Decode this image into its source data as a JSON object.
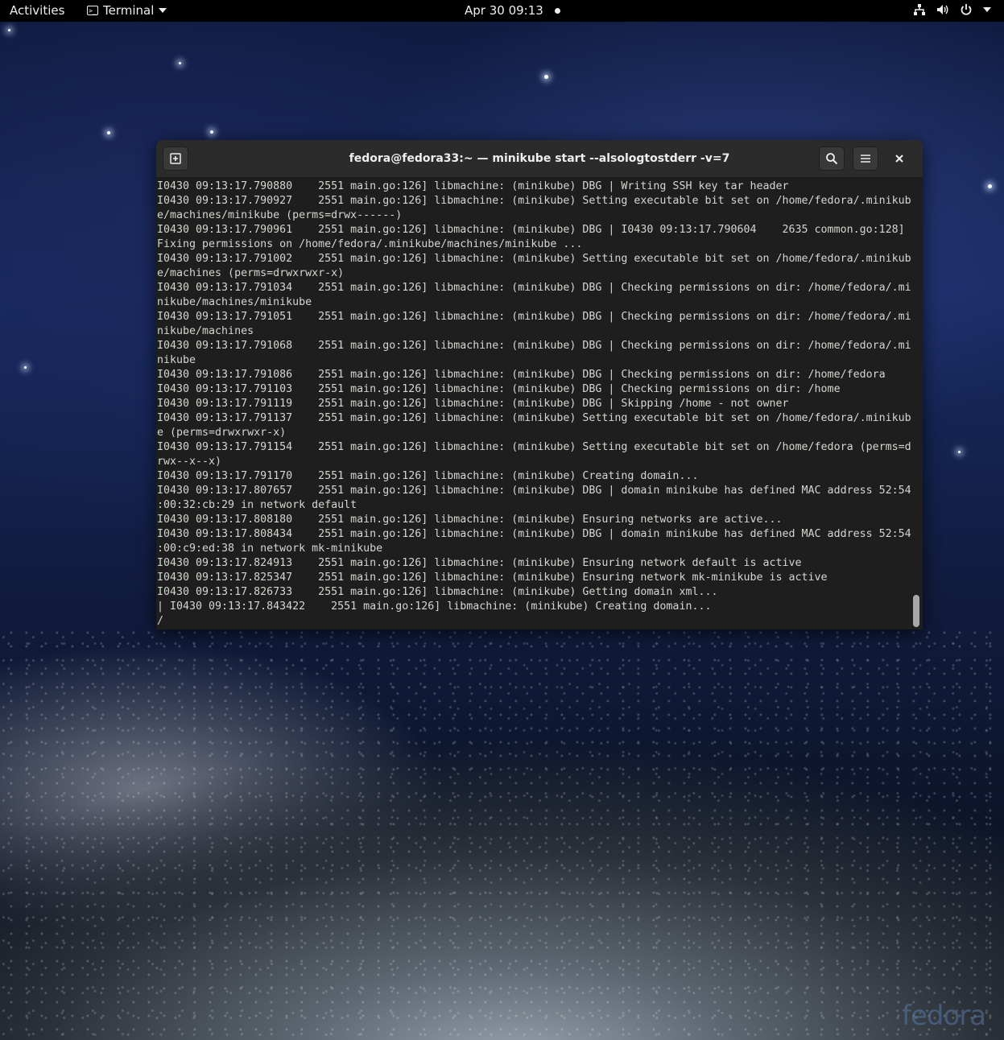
{
  "topbar": {
    "activities": "Activities",
    "app_name": "Terminal",
    "app_icon": "terminal-app-icon",
    "clock": "Apr 30  09:13",
    "status_icons": [
      "network-wired-icon",
      "volume-icon",
      "power-icon",
      "chevron-down-icon"
    ]
  },
  "window": {
    "title": "fedora@fedora33:~ — minikube start --alsologtostderr -v=7",
    "new_tab_icon": "new-tab-icon",
    "search_icon": "search-icon",
    "menu_icon": "hamburger-menu-icon",
    "close_icon": "close-icon"
  },
  "terminal": {
    "lines": [
      "I0430 09:13:17.790880    2551 main.go:126] libmachine: (minikube) DBG | Writing SSH key tar header",
      "I0430 09:13:17.790927    2551 main.go:126] libmachine: (minikube) Setting executable bit set on /home/fedora/.minikub",
      "e/machines/minikube (perms=drwx------)",
      "I0430 09:13:17.790961    2551 main.go:126] libmachine: (minikube) DBG | I0430 09:13:17.790604    2635 common.go:128]",
      "Fixing permissions on /home/fedora/.minikube/machines/minikube ...",
      "I0430 09:13:17.791002    2551 main.go:126] libmachine: (minikube) Setting executable bit set on /home/fedora/.minikub",
      "e/machines (perms=drwxrwxr-x)",
      "I0430 09:13:17.791034    2551 main.go:126] libmachine: (minikube) DBG | Checking permissions on dir: /home/fedora/.mi",
      "nikube/machines/minikube",
      "I0430 09:13:17.791051    2551 main.go:126] libmachine: (minikube) DBG | Checking permissions on dir: /home/fedora/.mi",
      "nikube/machines",
      "I0430 09:13:17.791068    2551 main.go:126] libmachine: (minikube) DBG | Checking permissions on dir: /home/fedora/.mi",
      "nikube",
      "I0430 09:13:17.791086    2551 main.go:126] libmachine: (minikube) DBG | Checking permissions on dir: /home/fedora",
      "I0430 09:13:17.791103    2551 main.go:126] libmachine: (minikube) DBG | Checking permissions on dir: /home",
      "I0430 09:13:17.791119    2551 main.go:126] libmachine: (minikube) DBG | Skipping /home - not owner",
      "I0430 09:13:17.791137    2551 main.go:126] libmachine: (minikube) Setting executable bit set on /home/fedora/.minikub",
      "e (perms=drwxrwxr-x)",
      "I0430 09:13:17.791154    2551 main.go:126] libmachine: (minikube) Setting executable bit set on /home/fedora (perms=d",
      "rwx--x--x)",
      "I0430 09:13:17.791170    2551 main.go:126] libmachine: (minikube) Creating domain...",
      "I0430 09:13:17.807657    2551 main.go:126] libmachine: (minikube) DBG | domain minikube has defined MAC address 52:54",
      ":00:32:cb:29 in network default",
      "I0430 09:13:17.808180    2551 main.go:126] libmachine: (minikube) Ensuring networks are active...",
      "I0430 09:13:17.808434    2551 main.go:126] libmachine: (minikube) DBG | domain minikube has defined MAC address 52:54",
      ":00:c9:ed:38 in network mk-minikube",
      "I0430 09:13:17.824913    2551 main.go:126] libmachine: (minikube) Ensuring network default is active",
      "I0430 09:13:17.825347    2551 main.go:126] libmachine: (minikube) Ensuring network mk-minikube is active",
      "I0430 09:13:17.826733    2551 main.go:126] libmachine: (minikube) Getting domain xml...",
      "| I0430 09:13:17.843422    2551 main.go:126] libmachine: (minikube) Creating domain...",
      "/"
    ]
  },
  "desktop": {
    "watermark": "fedora"
  }
}
